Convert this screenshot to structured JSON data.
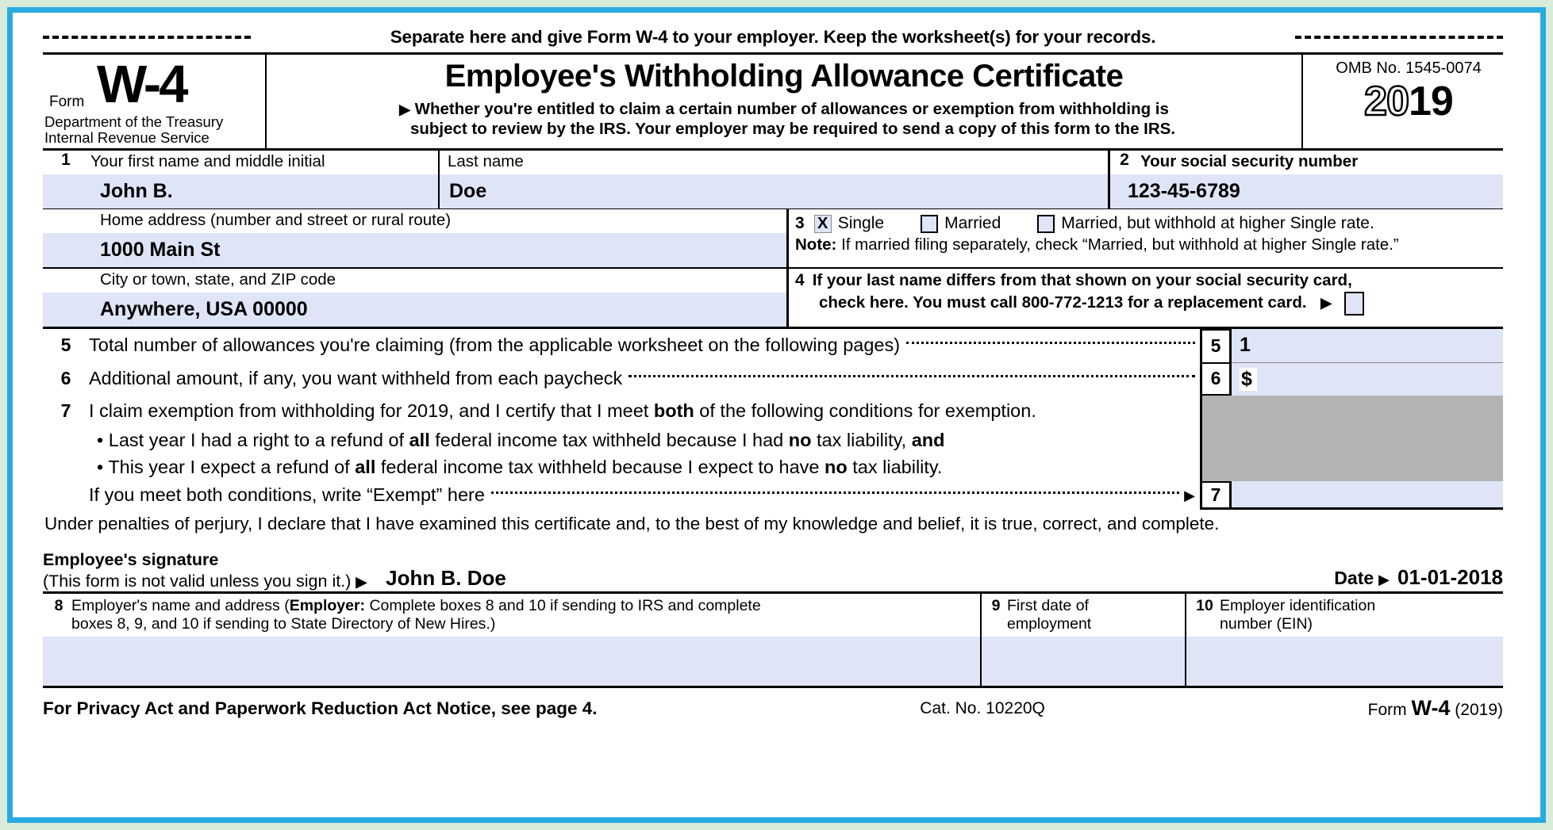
{
  "colors": {
    "page_background": "#d8ecd9",
    "frame_border": "#29abe2",
    "field_fill": "#dfe5f7",
    "shaded_block": "#b3b3b3",
    "text": "#000000"
  },
  "separate_notice": {
    "text": "Separate here and give Form W-4 to your employer. Keep the worksheet(s) for your records.",
    "left_rule": "dashed-rule",
    "right_rule": "dashed-rule"
  },
  "header": {
    "form_word": "Form",
    "form_number": "W-4",
    "department_line1": "Department of the Treasury",
    "department_line2": "Internal Revenue Service",
    "title": "Employee's Withholding Allowance Certificate",
    "subtitle_line1": "Whether you're entitled to claim a certain number of allowances or exemption from withholding is",
    "subtitle_line2": "subject to review by the IRS. Your employer may be required to send a copy of this form to the IRS.",
    "subtitle_arrow": "▶",
    "omb": "OMB No. 1545-0074",
    "year_hollow": "20",
    "year_solid": "19"
  },
  "line1": {
    "number": "1",
    "first_name_label": "Your first name and middle initial",
    "first_name_value": "John B.",
    "last_name_label": "Last name",
    "last_name_value": "Doe"
  },
  "line2": {
    "number": "2",
    "label": "Your social security number",
    "value": "123-45-6789"
  },
  "address": {
    "home_label": "Home address (number and street or rural route)",
    "home_value": "1000 Main St",
    "city_label": "City or town, state, and ZIP code",
    "city_value": "Anywhere, USA 00000"
  },
  "line3": {
    "number": "3",
    "options": [
      {
        "label": "Single",
        "checked": true,
        "mark": "X"
      },
      {
        "label": "Married",
        "checked": false,
        "mark": ""
      },
      {
        "label": "Married, but withhold at higher Single rate.",
        "checked": false,
        "mark": ""
      }
    ],
    "note_bold": "Note:",
    "note_text": " If married filing separately, check “Married, but withhold at higher Single rate.”"
  },
  "line4": {
    "number": "4",
    "text_line1": "If your last name differs from that shown on your social security card,",
    "text_line2": "check here. You must call 800-772-1213 for a replacement card.",
    "arrow": "▶",
    "checked": false
  },
  "line5": {
    "number": "5",
    "text": "Total number of allowances you're claiming (from the applicable worksheet on the following pages)",
    "box_number": "5",
    "value": "1"
  },
  "line6": {
    "number": "6",
    "text": "Additional amount, if any, you want withheld from each paycheck",
    "box_number": "6",
    "currency_symbol": "$",
    "value": ""
  },
  "line7": {
    "number": "7",
    "intro_pre": "I claim exemption from withholding for 2019, and I certify that I meet ",
    "intro_bold": "both",
    "intro_post": " of the following conditions for exemption.",
    "bullet1_pre": "• Last year I had a right to a refund of ",
    "bullet1_b1": "all",
    "bullet1_mid": " federal income tax withheld because I had ",
    "bullet1_b2": "no",
    "bullet1_post": " tax liability, ",
    "bullet1_b3": "and",
    "bullet2_pre": "• This year I expect a refund of ",
    "bullet2_b1": "all",
    "bullet2_mid": " federal income tax withheld because I expect to have ",
    "bullet2_b2": "no",
    "bullet2_post": " tax liability.",
    "final_text": "If you meet both conditions, write “Exempt” here",
    "arrow": "▶",
    "box_number": "7",
    "value": ""
  },
  "perjury": "Under penalties of perjury, I declare that I have examined this certificate and, to the best of my knowledge and belief, it is true, correct, and complete.",
  "signature": {
    "label_line1": "Employee's signature",
    "label_line2": "(This form is not valid unless you sign it.)",
    "arrow": "▶",
    "value": "John B. Doe",
    "date_label": "Date",
    "date_arrow": "▶",
    "date_value": "01-01-2018"
  },
  "line8": {
    "number": "8",
    "label_pre": "Employer's name and address (",
    "label_bold": "Employer:",
    "label_post": " Complete boxes 8 and 10 if sending to IRS and complete",
    "label_line2": "boxes 8, 9, and 10 if sending to State Directory of New Hires.)",
    "value": ""
  },
  "line9": {
    "number": "9",
    "label_line1": "First date of",
    "label_line2": "employment",
    "value": ""
  },
  "line10": {
    "number": "10",
    "label_line1": "Employer identification",
    "label_line2": "number (EIN)",
    "value": ""
  },
  "footer": {
    "privacy": "For Privacy Act and Paperwork Reduction Act Notice, see page 4.",
    "cat_no": "Cat. No. 10220Q",
    "form_word": "Form",
    "form_number": "W-4",
    "form_year": "(2019)"
  }
}
